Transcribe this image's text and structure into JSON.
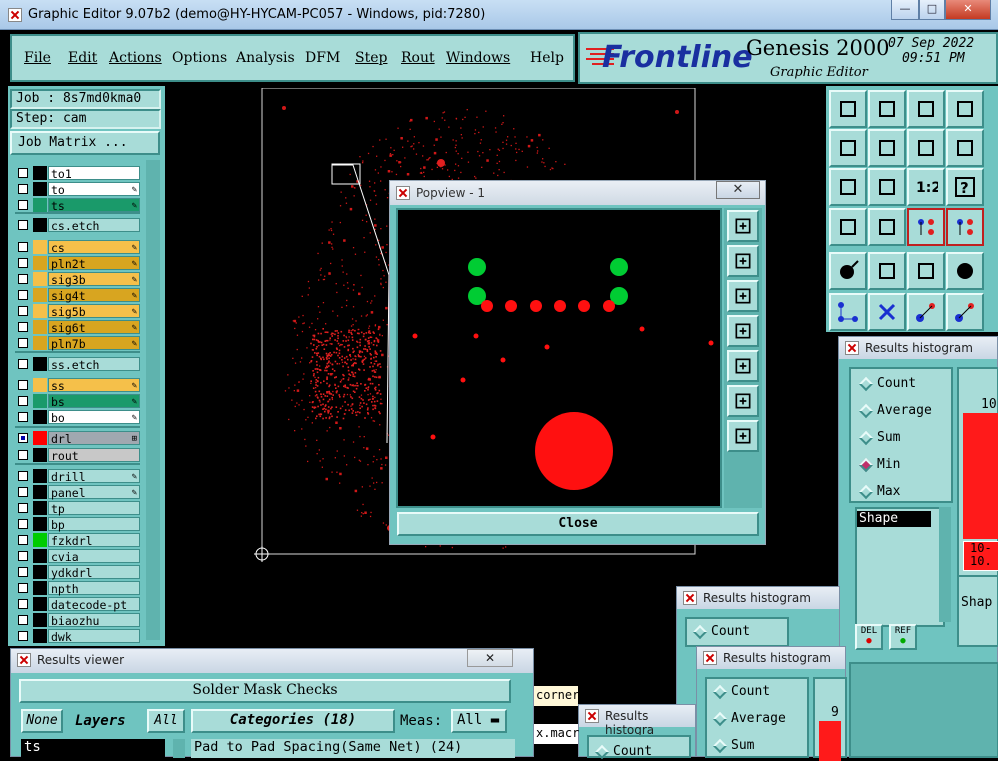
{
  "window": {
    "title": "Graphic Editor 9.07b2 (demo@HY-HYCAM-PC057 - Windows, pid:7280)",
    "min": "—",
    "max": "□",
    "close": "✕"
  },
  "menu": {
    "file": "File",
    "edit": "Edit",
    "actions": "Actions",
    "options": "Options",
    "analysis": "Analysis",
    "dfm": "DFM",
    "step": "Step",
    "rout": "Rout",
    "windows": "Windows",
    "help": "Help"
  },
  "brand": {
    "logo": "Frontline",
    "product": "Genesis 2000",
    "subtitle": "Graphic Editor",
    "date": "07 Sep 2022",
    "time": "09:51 PM"
  },
  "job": {
    "job": "Job : 8s7md0kma0",
    "step": "Step: cam",
    "matrix": "Job Matrix ..."
  },
  "layers": [
    {
      "name": "to1",
      "color": "#ffffff",
      "bg": "#ffffff",
      "icon": ""
    },
    {
      "name": "to",
      "color": "#ffffff",
      "bg": "#ffffff",
      "icon": "✎"
    },
    {
      "name": "ts",
      "color": "#1a9a6a",
      "bg": "#1a9a6a",
      "icon": "✎"
    },
    {
      "name": "cs.etch",
      "color": "#a8dcd8",
      "bg": "#a8dcd8",
      "icon": ""
    },
    {
      "name": "cs",
      "color": "#f5c04a",
      "bg": "#f5c04a",
      "icon": "✎"
    },
    {
      "name": "pln2t",
      "color": "#d8a520",
      "bg": "#d8a520",
      "icon": "✎"
    },
    {
      "name": "sig3b",
      "color": "#f5c04a",
      "bg": "#f5c04a",
      "icon": "✎"
    },
    {
      "name": "sig4t",
      "color": "#d8a520",
      "bg": "#d8a520",
      "icon": "✎"
    },
    {
      "name": "sig5b",
      "color": "#f5c04a",
      "bg": "#f5c04a",
      "icon": "✎"
    },
    {
      "name": "sig6t",
      "color": "#d8a520",
      "bg": "#d8a520",
      "icon": "✎"
    },
    {
      "name": "pln7b",
      "color": "#d8a520",
      "bg": "#d8a520",
      "icon": "✎"
    },
    {
      "name": "ss.etch",
      "color": "#a8dcd8",
      "bg": "#a8dcd8",
      "icon": ""
    },
    {
      "name": "ss",
      "color": "#f5c04a",
      "bg": "#f5c04a",
      "icon": "✎"
    },
    {
      "name": "bs",
      "color": "#1a9a6a",
      "bg": "#1a9a6a",
      "icon": "✎"
    },
    {
      "name": "bo",
      "color": "#ffffff",
      "bg": "#ffffff",
      "icon": "✎"
    },
    {
      "name": "drl",
      "color": "#ff0000",
      "bg": "#a0a8b0",
      "icon": "⊞"
    },
    {
      "name": "rout",
      "color": "#c8c8c8",
      "bg": "#c8c8c8",
      "icon": ""
    },
    {
      "name": "drill",
      "color": "#a8dcd8",
      "bg": "#a8dcd8",
      "icon": "✎"
    },
    {
      "name": "panel",
      "color": "#a8dcd8",
      "bg": "#a8dcd8",
      "icon": "✎"
    },
    {
      "name": "tp",
      "color": "#a8dcd8",
      "bg": "#a8dcd8",
      "icon": ""
    },
    {
      "name": "bp",
      "color": "#a8dcd8",
      "bg": "#a8dcd8",
      "icon": ""
    },
    {
      "name": "fzkdrl",
      "color": "#00cc00",
      "bg": "#a8dcd8",
      "icon": ""
    },
    {
      "name": "cvia",
      "color": "#a8dcd8",
      "bg": "#a8dcd8",
      "icon": ""
    },
    {
      "name": "ydkdrl",
      "color": "#a8dcd8",
      "bg": "#a8dcd8",
      "icon": ""
    },
    {
      "name": "npth",
      "color": "#a8dcd8",
      "bg": "#a8dcd8",
      "icon": ""
    },
    {
      "name": "datecode-pt",
      "color": "#a8dcd8",
      "bg": "#a8dcd8",
      "icon": ""
    },
    {
      "name": "biaozhu",
      "color": "#a8dcd8",
      "bg": "#a8dcd8",
      "icon": ""
    },
    {
      "name": "dwk",
      "color": "#a8dcd8",
      "bg": "#a8dcd8",
      "icon": ""
    }
  ],
  "popview": {
    "title": "Popview - 1",
    "close": "Close"
  },
  "histo_main": {
    "title": "Results histogram",
    "options": [
      "Count",
      "Average",
      "Sum",
      "Min",
      "Max"
    ],
    "selected": "Min",
    "field": "Shape",
    "del": "DEL",
    "ref": "REF",
    "bar_top": "10",
    "bar_range": "10-\n10."
  },
  "histo_side_field": "Shap",
  "histo2": {
    "title": "Results histogram",
    "option": "Count"
  },
  "histo3": {
    "title": "Results histogram",
    "options": [
      "Count",
      "Average",
      "Sum"
    ],
    "bar_top": "9"
  },
  "histo4": {
    "title": "Results histogra",
    "option": "Count"
  },
  "viewer": {
    "title": "Results viewer",
    "heading": "Solder Mask Checks",
    "none": "None",
    "layers": "Layers",
    "all": "All",
    "categories": "Categories (18)",
    "meas": "Meas:",
    "meas_val": "All",
    "layer_val": "ts",
    "row": "Pad to Pad Spacing(Same Net) (24)"
  },
  "snippets": {
    "corner": "corner",
    "macro": "x.macr"
  }
}
